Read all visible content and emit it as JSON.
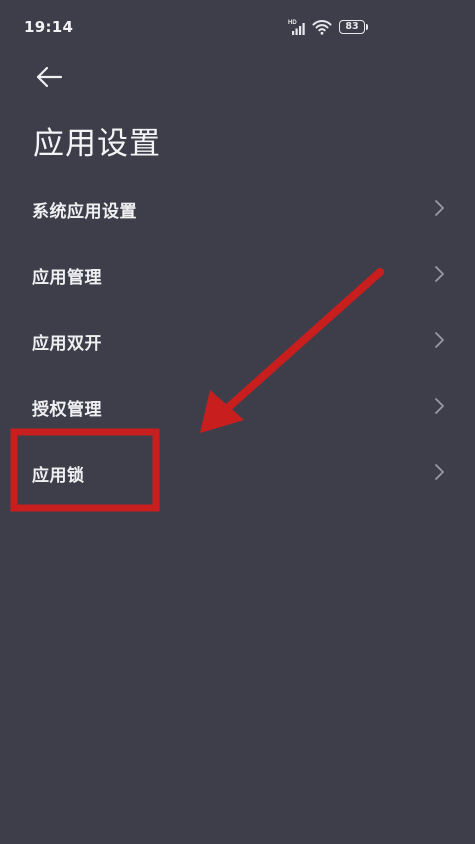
{
  "status_bar": {
    "time": "19:14",
    "network_label": "HD",
    "battery_level": "83",
    "icons": [
      "signal-icon",
      "wifi-icon",
      "battery-icon"
    ]
  },
  "header": {
    "back_icon": "arrow-left-icon",
    "title": "应用设置"
  },
  "menu": {
    "items": [
      {
        "label": "系统应用设置",
        "icon": "chevron-right-icon"
      },
      {
        "label": "应用管理",
        "icon": "chevron-right-icon"
      },
      {
        "label": "应用双开",
        "icon": "chevron-right-icon"
      },
      {
        "label": "授权管理",
        "icon": "chevron-right-icon"
      },
      {
        "label": "应用锁",
        "icon": "chevron-right-icon",
        "highlighted": true
      }
    ]
  },
  "annotation": {
    "color": "#c81e1e",
    "target": "应用锁"
  },
  "colors": {
    "background": "#3e3e4a",
    "text": "#f0f0f3",
    "chevron": "#9a9aa6"
  }
}
